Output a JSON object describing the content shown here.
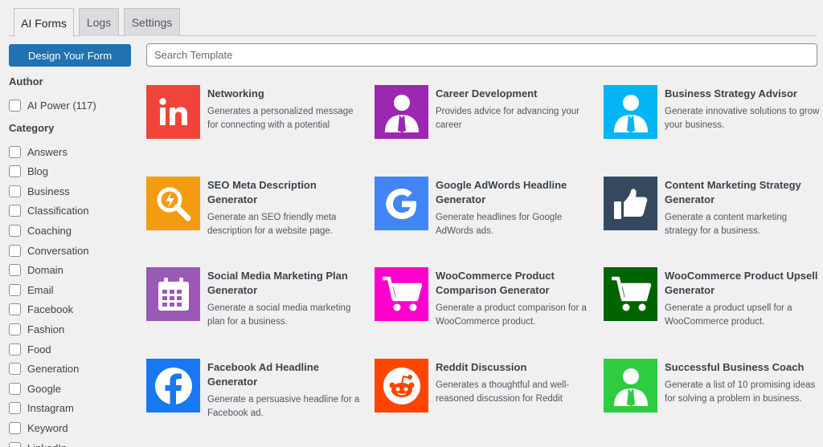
{
  "tabs": [
    "AI Forms",
    "Logs",
    "Settings"
  ],
  "sidebar": {
    "design_button": "Design Your Form",
    "author_title": "Author",
    "author_items": [
      "AI Power (117)"
    ],
    "category_title": "Category",
    "categories": [
      "Answers",
      "Blog",
      "Business",
      "Classification",
      "Coaching",
      "Conversation",
      "Domain",
      "Email",
      "Facebook",
      "Fashion",
      "Food",
      "Generation",
      "Google",
      "Instagram",
      "Keyword",
      "LinkedIn"
    ]
  },
  "search": {
    "placeholder": "Search Template"
  },
  "templates": [
    {
      "title": "Networking",
      "desc": "Generates a personalized message for connecting with a potential",
      "icon": "linkedin-icon",
      "color": "#f04438"
    },
    {
      "title": "Career Development",
      "desc": "Provides advice for advancing your career",
      "icon": "person-icon",
      "color": "#9c27b0"
    },
    {
      "title": "Business Strategy Advisor",
      "desc": "Generate innovative solutions to grow your business.",
      "icon": "person-icon",
      "color": "#03b5f4"
    },
    {
      "title": "SEO Meta Description Generator",
      "desc": "Generate an SEO friendly meta description for a website page.",
      "icon": "seo-search-icon",
      "color": "#f39c12"
    },
    {
      "title": "Google AdWords Headline Generator",
      "desc": "Generate headlines for Google AdWords ads.",
      "icon": "google-icon",
      "color": "#4285f4"
    },
    {
      "title": "Content Marketing Strategy Generator",
      "desc": "Generate a content marketing strategy for a business.",
      "icon": "thumbs-up-icon",
      "color": "#34495e"
    },
    {
      "title": "Social Media Marketing Plan Generator",
      "desc": "Generate a social media marketing plan for a business.",
      "icon": "calendar-icon",
      "color": "#9b59b6"
    },
    {
      "title": "WooCommerce Product Comparison Generator",
      "desc": "Generate a product comparison for a WooCommerce product.",
      "icon": "cart-icon",
      "color": "#ff00cc"
    },
    {
      "title": "WooCommerce Product Upsell Generator",
      "desc": "Generate a product upsell for a WooCommerce product.",
      "icon": "cart-icon",
      "color": "#006400"
    },
    {
      "title": "Facebook Ad Headline Generator",
      "desc": "Generate a persuasive headline for a Facebook ad.",
      "icon": "facebook-icon",
      "color": "#1877f2"
    },
    {
      "title": "Reddit Discussion",
      "desc": "Generates a thoughtful and well-reasoned discussion for Reddit",
      "icon": "reddit-icon",
      "color": "#ff4500"
    },
    {
      "title": "Successful Business Coach",
      "desc": "Generate a list of 10 promising ideas for solving a problem in business.",
      "icon": "person-icon",
      "color": "#2ecc40"
    }
  ]
}
